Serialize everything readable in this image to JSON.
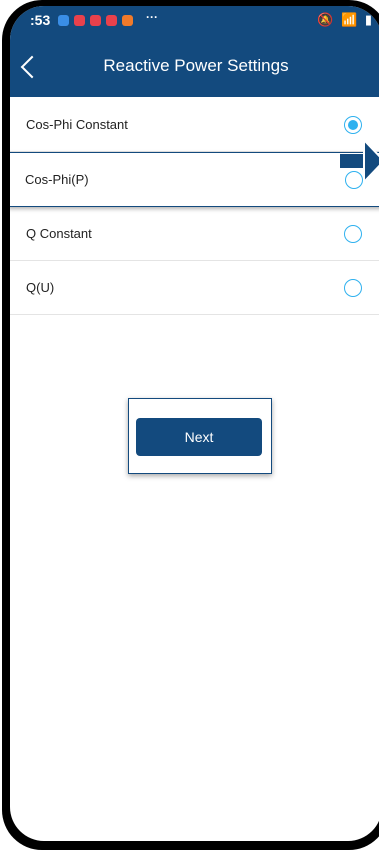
{
  "status_bar": {
    "time": ":53",
    "more": "···",
    "system_icons": "🔕 📶 ▮"
  },
  "header": {
    "title": "Reactive Power Settings"
  },
  "options": [
    {
      "label": "Cos-Phi Constant",
      "selected": true
    },
    {
      "label": "Cos-Phi(P)",
      "selected": false
    },
    {
      "label": "Q Constant",
      "selected": false
    },
    {
      "label": "Q(U)",
      "selected": false
    }
  ],
  "next_button": {
    "label": "Next"
  },
  "colors": {
    "header": "#134a7e",
    "radio": "#2fb1ef",
    "button": "#134a7e"
  }
}
